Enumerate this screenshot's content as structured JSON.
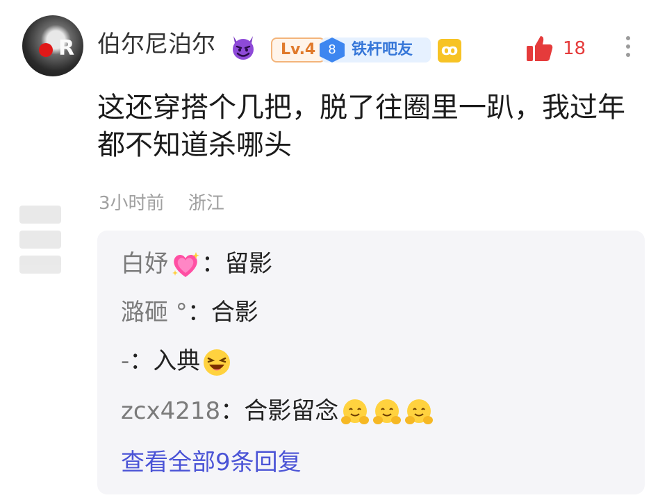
{
  "post": {
    "username": "伯尔尼泊尔",
    "badges": {
      "level": "Lv.4",
      "member_num": "8",
      "member_label": "铁杆吧友",
      "tag_icon": "ꝏ"
    },
    "likes": "18",
    "content": "这还穿搭个几把，脱了往圈里一趴，我过年都不知道杀哪头",
    "time": "3小时前",
    "location": "浙江"
  },
  "replies": [
    {
      "name": "白妤",
      "text": "留影",
      "emoji": "sparkling-heart"
    },
    {
      "name": "潞砸 °",
      "text": "合影"
    },
    {
      "name": "-",
      "text": "入典",
      "emoji": "laughing-face"
    },
    {
      "name": "zcx4218",
      "text": "合影留念",
      "emoji": "hugging-face",
      "emoji_count": 3
    }
  ],
  "view_all": "查看全部9条回复",
  "colors": {
    "like": "#e53b3b",
    "link": "#4b54d6",
    "level_badge": "#e07a2c",
    "member_badge": "#3576d8",
    "reply_bg": "#f5f5f8"
  }
}
